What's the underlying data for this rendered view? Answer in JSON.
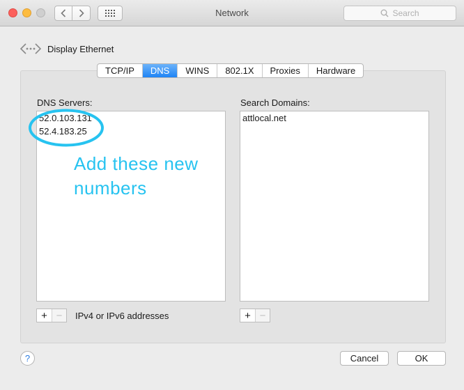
{
  "window": {
    "title": "Network"
  },
  "search": {
    "placeholder": "Search"
  },
  "header": {
    "label": "Display Ethernet"
  },
  "tabs": [
    {
      "label": "TCP/IP",
      "active": false
    },
    {
      "label": "DNS",
      "active": true
    },
    {
      "label": "WINS",
      "active": false
    },
    {
      "label": "802.1X",
      "active": false
    },
    {
      "label": "Proxies",
      "active": false
    },
    {
      "label": "Hardware",
      "active": false
    }
  ],
  "dns": {
    "label": "DNS Servers:",
    "servers": [
      "52.0.103.131",
      "52.4.183.25"
    ],
    "hint": "IPv4 or IPv6 addresses",
    "add_label": "+",
    "remove_label": "−"
  },
  "domains": {
    "label": "Search Domains:",
    "items": [
      "attlocal.net"
    ],
    "add_label": "+",
    "remove_label": "−"
  },
  "annotation": {
    "line1": "Add these new",
    "line2": "numbers",
    "color": "#27c3f0"
  },
  "footer": {
    "help_label": "?",
    "cancel_label": "Cancel",
    "ok_label": "OK"
  }
}
